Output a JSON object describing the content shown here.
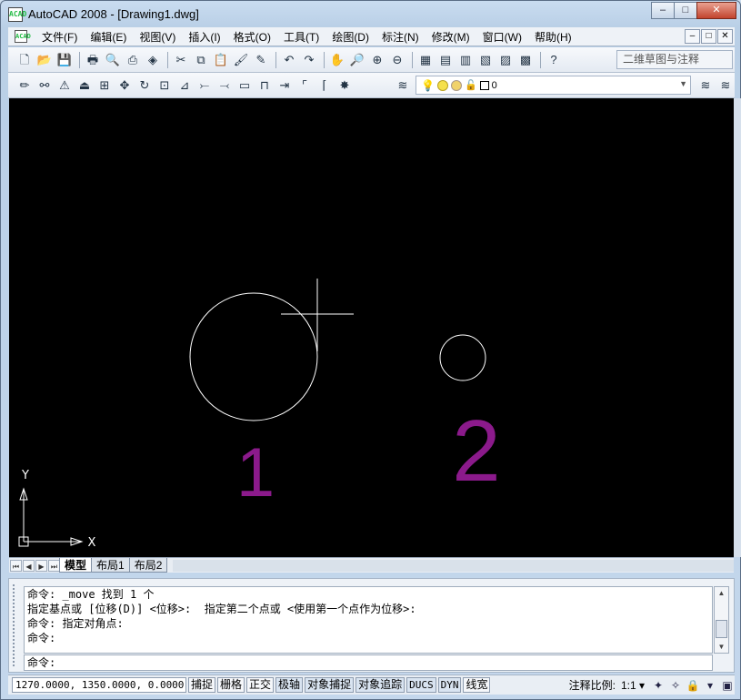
{
  "window": {
    "title": "AutoCAD 2008 - [Drawing1.dwg]",
    "icon_text": "ACAD"
  },
  "caption_buttons": {
    "minimize": "–",
    "restore": "□",
    "close": "✕"
  },
  "menu": {
    "items": [
      "文件(F)",
      "编辑(E)",
      "视图(V)",
      "插入(I)",
      "格式(O)",
      "工具(T)",
      "绘图(D)",
      "标注(N)",
      "修改(M)",
      "窗口(W)",
      "帮助(H)"
    ],
    "mdi_buttons": {
      "minimize": "–",
      "restore": "□",
      "close": "✕"
    }
  },
  "toolbar1": {
    "workspace": "二维草图与注释"
  },
  "toolbar2": {
    "layer_name": "0"
  },
  "canvas": {
    "label_1": "1",
    "label_2": "2",
    "ucs_x": "X",
    "ucs_y": "Y",
    "colors": {
      "background": "#000000",
      "entities": "#ffffff",
      "labels": "#8b1a8b"
    }
  },
  "layout_tabs": {
    "tabs": [
      "模型",
      "布局1",
      "布局2"
    ],
    "active": "模型"
  },
  "command": {
    "history": [
      "命令: _move 找到 1 个",
      "指定基点或 [位移(D)] <位移>:  指定第二个点或 <使用第一个点作为位移>:",
      "命令: 指定对角点:",
      "命令:"
    ],
    "prompt": "命令:"
  },
  "status": {
    "coords": "1270.0000, 1350.0000, 0.0000",
    "toggles": [
      "捕捉",
      "栅格",
      "正交",
      "极轴",
      "对象捕捉",
      "对象追踪",
      "DUCS",
      "DYN",
      "线宽"
    ],
    "annotation_scale_label": "注释比例:",
    "annotation_scale_value": "1:1 ▾"
  }
}
